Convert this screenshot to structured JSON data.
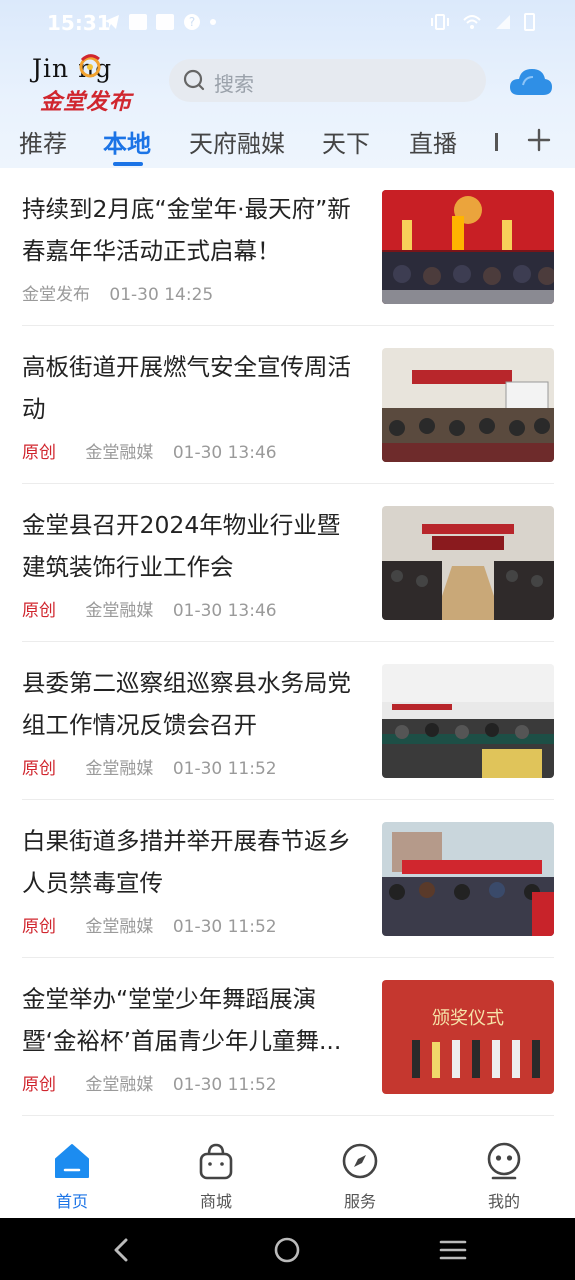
{
  "status_bar": {
    "time": "15:31"
  },
  "header": {
    "logo_en": "Jin ng",
    "logo_cn": "金堂发布",
    "search_placeholder": "搜索"
  },
  "tabs": [
    {
      "label": "推荐",
      "active": false
    },
    {
      "label": "本地",
      "active": true
    },
    {
      "label": "天府融媒",
      "active": false
    },
    {
      "label": "天下",
      "active": false
    },
    {
      "label": "直播",
      "active": false
    }
  ],
  "news": [
    {
      "title": "持续到2月底“金堂年·最天府”新春嘉年华活动正式启幕！",
      "original": "",
      "source": "金堂发布",
      "time": "01-30 14:25"
    },
    {
      "title": "高板街道开展燃气安全宣传周活动",
      "original": "原创",
      "source": "金堂融媒",
      "time": "01-30 13:46"
    },
    {
      "title": "金堂县召开2024年物业行业暨建筑装饰行业工作会",
      "original": "原创",
      "source": "金堂融媒",
      "time": "01-30 13:46"
    },
    {
      "title": "县委第二巡察组巡察县水务局党组工作情况反馈会召开",
      "original": "原创",
      "source": "金堂融媒",
      "time": "01-30 11:52"
    },
    {
      "title": "白果街道多措并举开展春节返乡人员禁毒宣传",
      "original": "原创",
      "source": "金堂融媒",
      "time": "01-30 11:52"
    },
    {
      "title": "金堂举办“堂堂少年舞蹈展演暨‘金裕杯’首届青少年儿童舞...",
      "original": "原创",
      "source": "金堂融媒",
      "time": "01-30 11:52"
    }
  ],
  "thumbs": {
    "t3_banner": "颁奖仪式"
  },
  "bottom_nav": [
    {
      "label": "首页",
      "active": true
    },
    {
      "label": "商城",
      "active": false
    },
    {
      "label": "服务",
      "active": false
    },
    {
      "label": "我的",
      "active": false
    }
  ],
  "colors": {
    "accent": "#1c74e6",
    "original_red": "#d0262e",
    "meta_gray": "#9a9a9a"
  }
}
